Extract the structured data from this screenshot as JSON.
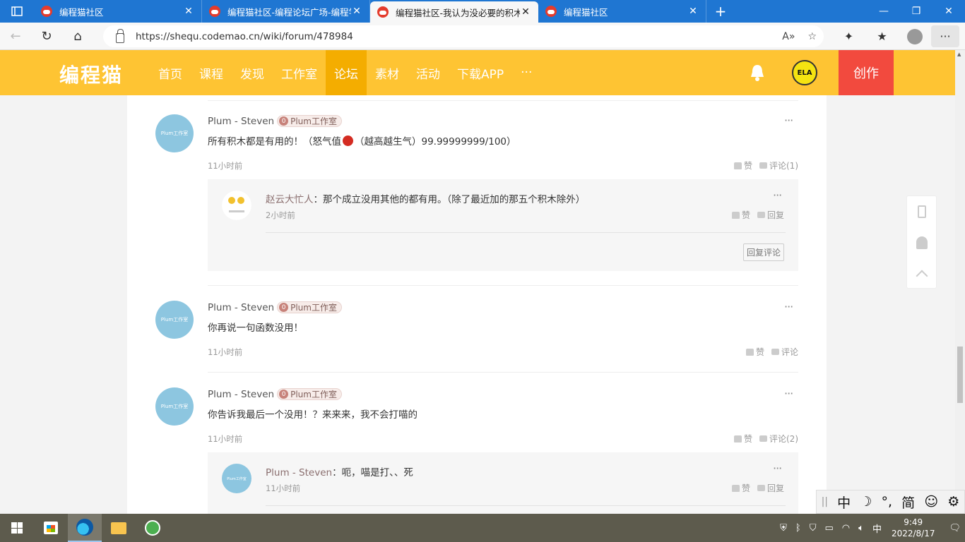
{
  "browser": {
    "tabs": [
      {
        "title": "编程猫社区",
        "active": false
      },
      {
        "title": "编程猫社区-编程论坛广场-编程学",
        "active": false
      },
      {
        "title": "编程猫社区-我认为没必要的积木",
        "active": true
      },
      {
        "title": "编程猫社区",
        "active": false
      }
    ],
    "url": "https://shequ.codemao.cn/wiki/forum/478984"
  },
  "site": {
    "logo": "编程猫",
    "nav": [
      "首页",
      "课程",
      "发现",
      "工作室",
      "论坛",
      "素材",
      "活动",
      "下载APP",
      "···"
    ],
    "active_nav": "论坛",
    "user_badge": "ELA",
    "create_label": "创作"
  },
  "comments": [
    {
      "author": "Plum - Steven",
      "studio": "Plum工作室",
      "studio_level": "0",
      "text_before": "所有积木都是有用的！（怒气值",
      "text_after": "（越高越生气）99.99999999/100）",
      "time": "11小时前",
      "like_label": "赞",
      "comment_label": "评论(1)",
      "reply": {
        "author": "赵云大忙人",
        "text": "：那个成立没用其他的都有用。（除了最近加的那五个积木除外）",
        "time": "2小时前",
        "like_label": "赞",
        "reply_label": "回复"
      },
      "reply_button": "回复评论"
    },
    {
      "author": "Plum - Steven",
      "studio": "Plum工作室",
      "studio_level": "0",
      "text": "你再说一句函数没用！",
      "time": "11小时前",
      "like_label": "赞",
      "comment_label": "评论"
    },
    {
      "author": "Plum - Steven",
      "studio": "Plum工作室",
      "studio_level": "0",
      "text": "你告诉我最后一个没用！？来来来，我不会打喵的",
      "time": "11小时前",
      "like_label": "赞",
      "comment_label": "评论(2)",
      "reply": {
        "author": "Plum - Steven",
        "text": "：呃，喵是打、、死",
        "time": "11小时前",
        "like_label": "赞",
        "reply_label": "回复"
      }
    }
  ],
  "ime": {
    "items": [
      "中",
      "☽",
      "°,",
      "简",
      "☺",
      "⚙"
    ]
  },
  "taskbar": {
    "tray_lang": "中",
    "time": "9:49",
    "date": "2022/8/17"
  },
  "colors": {
    "header": "#fec433",
    "nav_active": "#f4ad00",
    "create": "#f24a3e",
    "tab_strip": "#1f76d2"
  }
}
